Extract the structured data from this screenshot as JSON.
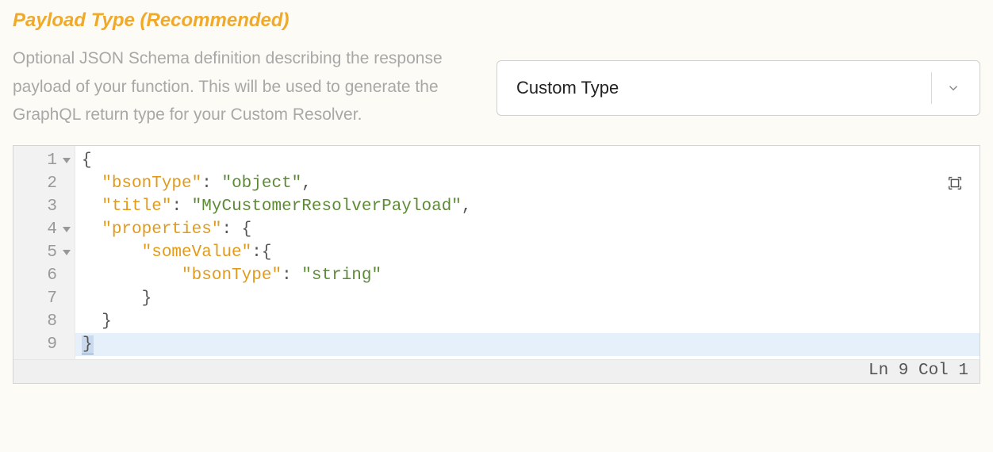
{
  "section": {
    "title": "Payload Type (Recommended)",
    "description": "Optional JSON Schema definition describing the response payload of your function. This will be used to generate the GraphQL return type for your Custom Resolver."
  },
  "select": {
    "value": "Custom Type"
  },
  "editor": {
    "lines": [
      {
        "num": "1",
        "fold": true
      },
      {
        "num": "2",
        "fold": false
      },
      {
        "num": "3",
        "fold": false
      },
      {
        "num": "4",
        "fold": true
      },
      {
        "num": "5",
        "fold": true
      },
      {
        "num": "6",
        "fold": false
      },
      {
        "num": "7",
        "fold": false
      },
      {
        "num": "8",
        "fold": false
      },
      {
        "num": "9",
        "fold": false
      }
    ],
    "code": {
      "l1": "{",
      "l2_key": "\"bsonType\"",
      "l2_val": "\"object\"",
      "l3_key": "\"title\"",
      "l3_val": "\"MyCustomerResolverPayload\"",
      "l4_key": "\"properties\"",
      "l5_key": "\"someValue\"",
      "l6_key": "\"bsonType\"",
      "l6_val": "\"string\"",
      "l7": "}",
      "l8": "}",
      "l9": "}"
    },
    "status": "Ln 9 Col 1"
  }
}
